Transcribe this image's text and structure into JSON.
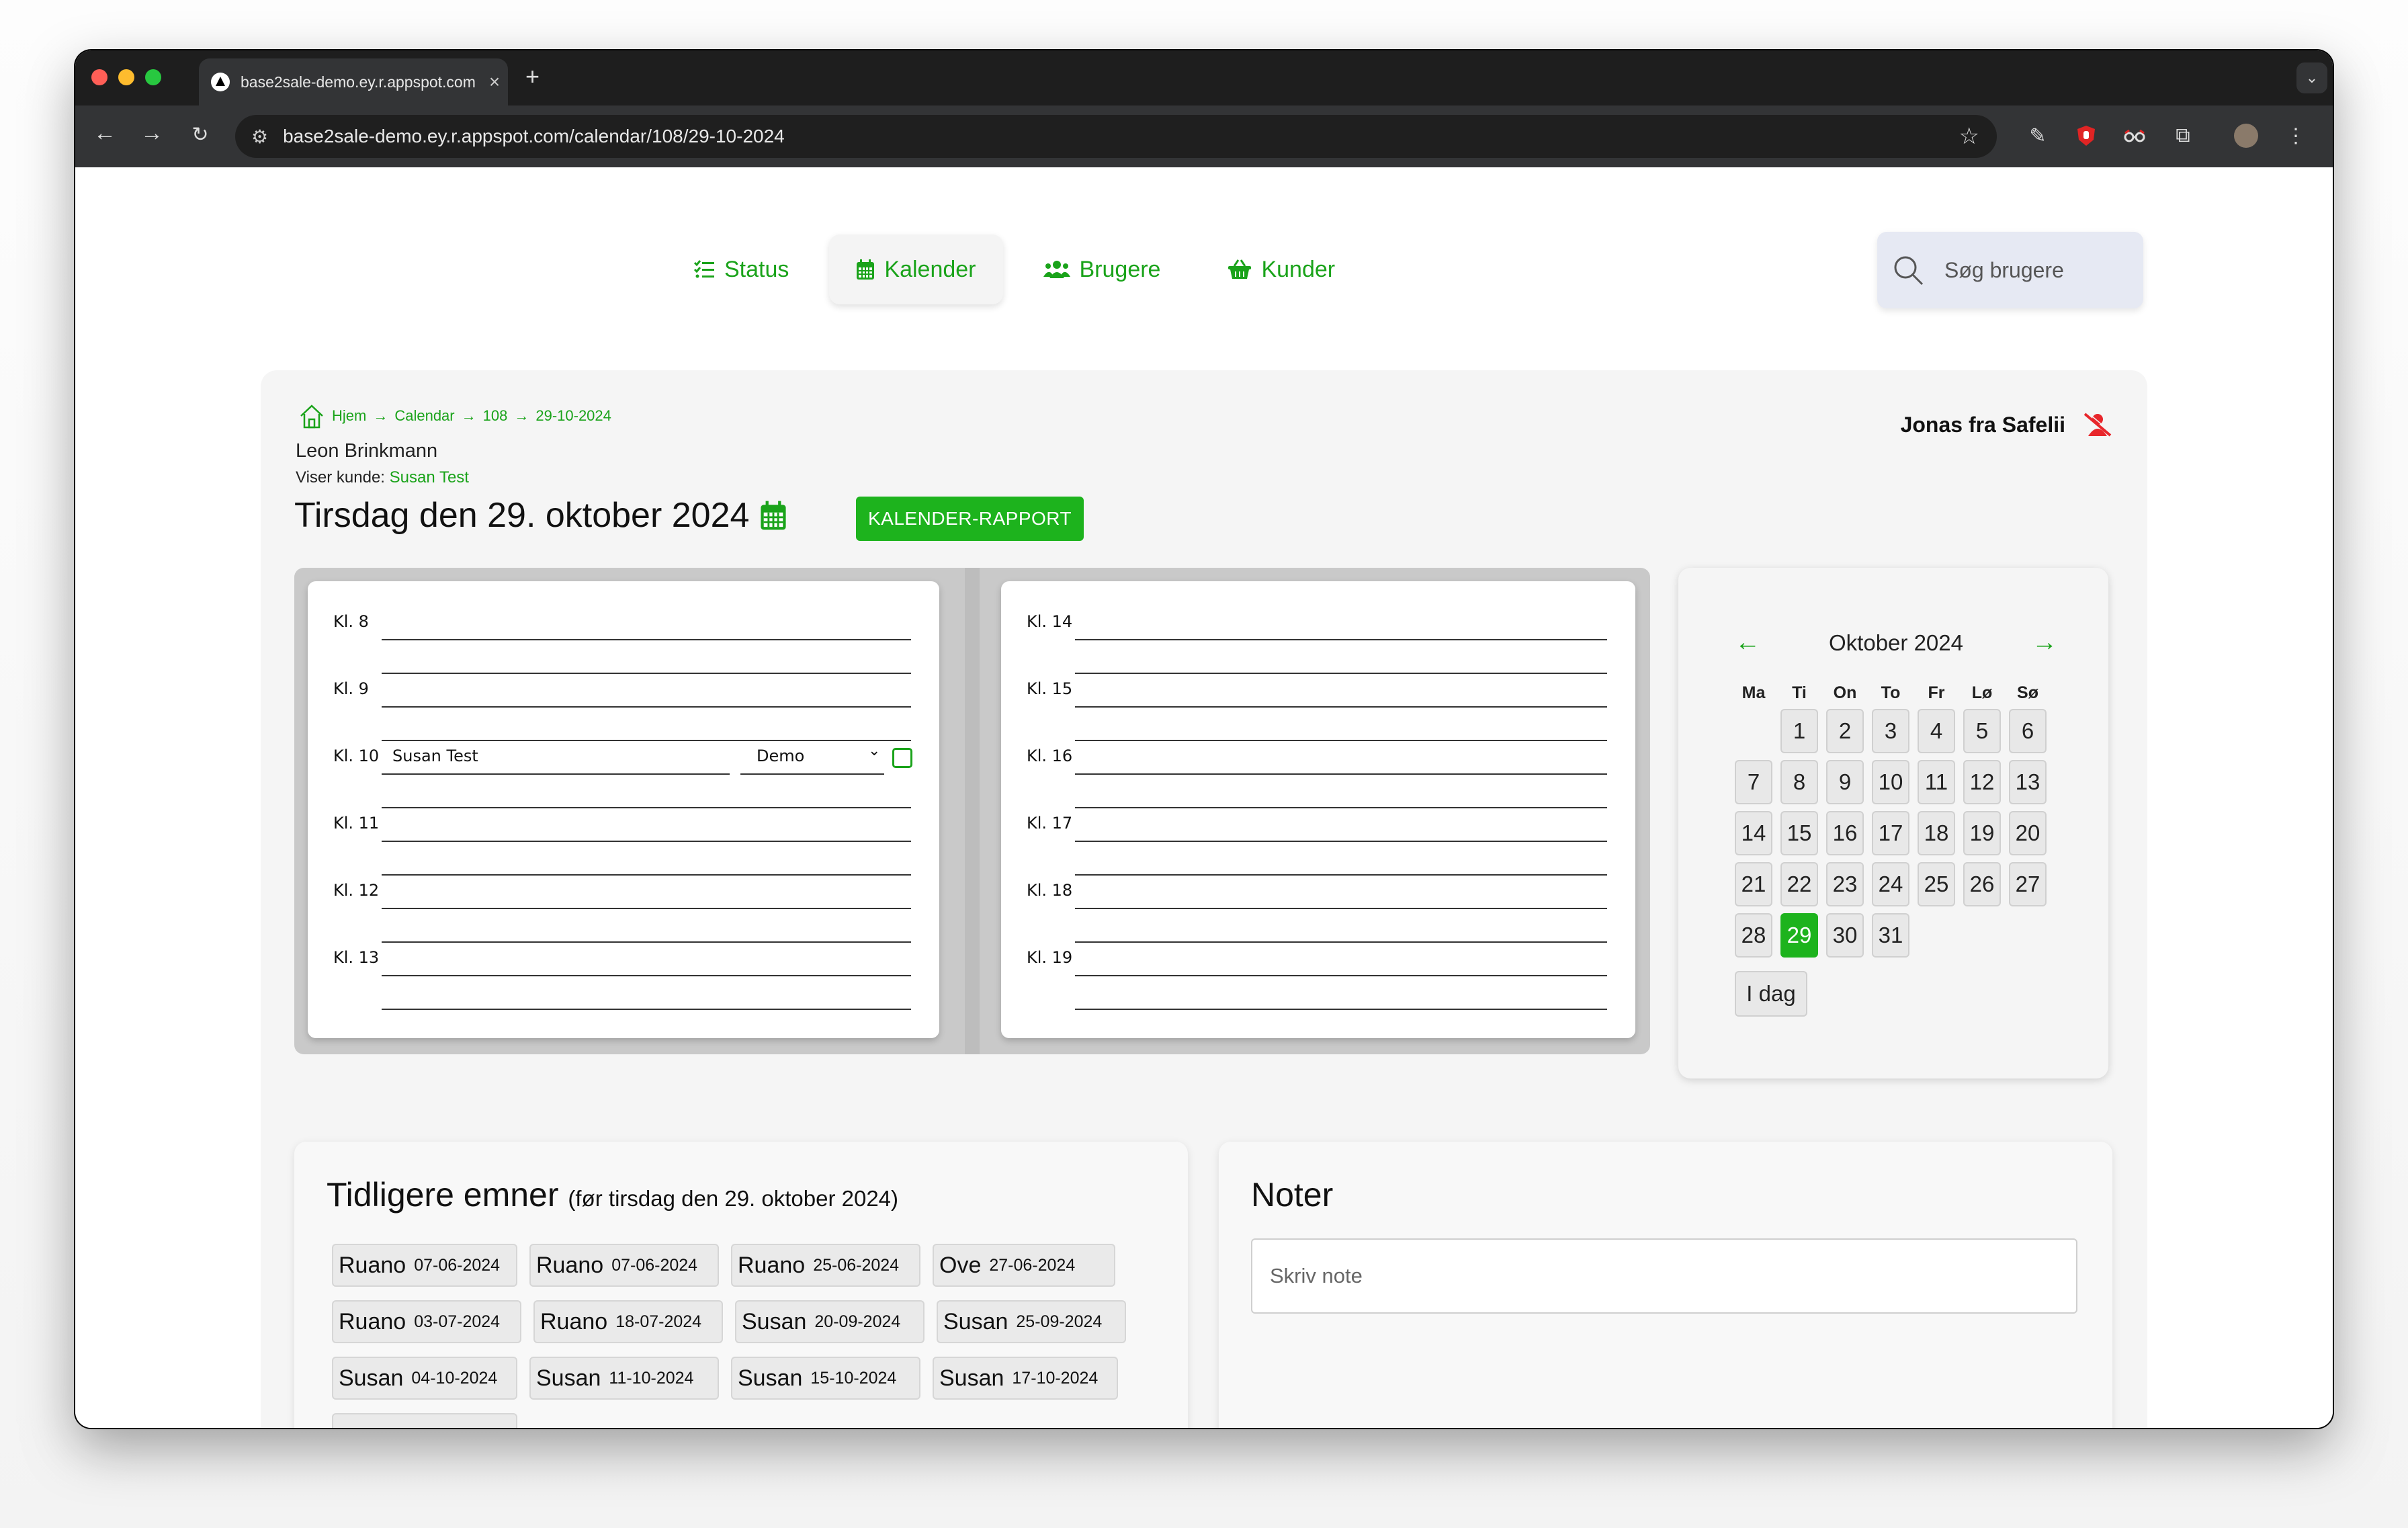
{
  "browser": {
    "tab_title": "base2sale-demo.ey.r.appspot.com",
    "tab_close": "×",
    "new_tab": "+",
    "url": "base2sale-demo.ey.r.appspot.com/calendar/108/29-10-2024"
  },
  "nav": {
    "items": [
      {
        "label": "Status",
        "icon": "list-check-icon"
      },
      {
        "label": "Kalender",
        "icon": "calendar-icon",
        "active": true
      },
      {
        "label": "Brugere",
        "icon": "users-icon"
      },
      {
        "label": "Kunder",
        "icon": "basket-icon"
      }
    ],
    "search_placeholder": "Søg brugere"
  },
  "breadcrumb": [
    "Hjem",
    "Calendar",
    "108",
    "29-10-2024"
  ],
  "breadcrumb_sep": "→",
  "agent_name": "Leon Brinkmann",
  "viser_label": "Viser kunde:",
  "viser_customer": "Susan Test",
  "date_heading": "Tirsdag den 29. oktober 2024",
  "report_button": "KALENDER-RAPPORT",
  "current_user": "Jonas fra Safelii",
  "schedule": {
    "left": [
      "Kl. 8",
      "Kl. 9",
      "Kl. 10",
      "Kl. 11",
      "Kl. 12",
      "Kl. 13"
    ],
    "right": [
      "Kl. 14",
      "Kl. 15",
      "Kl. 16",
      "Kl. 17",
      "Kl. 18",
      "Kl. 19"
    ],
    "entry_name": "Susan Test",
    "entry_type": "Demo"
  },
  "calendar": {
    "month": "Oktober 2024",
    "weekdays": [
      "Ma",
      "Ti",
      "On",
      "To",
      "Fr",
      "Lø",
      "Sø"
    ],
    "selected_day": 29,
    "today_button": "I dag",
    "prev": "←",
    "next": "→"
  },
  "earlier": {
    "title": "Tidligere emner",
    "subtitle": "(før tirsdag den 29. oktober 2024)",
    "topics": [
      {
        "name": "Ruano",
        "date": "07-06-2024"
      },
      {
        "name": "Ruano",
        "date": "07-06-2024"
      },
      {
        "name": "Ruano",
        "date": "25-06-2024"
      },
      {
        "name": "Ove",
        "date": "27-06-2024"
      },
      {
        "name": "Ruano",
        "date": "03-07-2024"
      },
      {
        "name": "Ruano",
        "date": "18-07-2024"
      },
      {
        "name": "Susan",
        "date": "20-09-2024"
      },
      {
        "name": "Susan",
        "date": "25-09-2024"
      },
      {
        "name": "Susan",
        "date": "04-10-2024"
      },
      {
        "name": "Susan",
        "date": "11-10-2024"
      },
      {
        "name": "Susan",
        "date": "15-10-2024"
      },
      {
        "name": "Susan",
        "date": "17-10-2024"
      }
    ]
  },
  "notes": {
    "title": "Noter",
    "placeholder": "Skriv note"
  },
  "colors": {
    "accent": "#1aa31a",
    "button": "#1db31d",
    "danger": "#e8262b"
  }
}
